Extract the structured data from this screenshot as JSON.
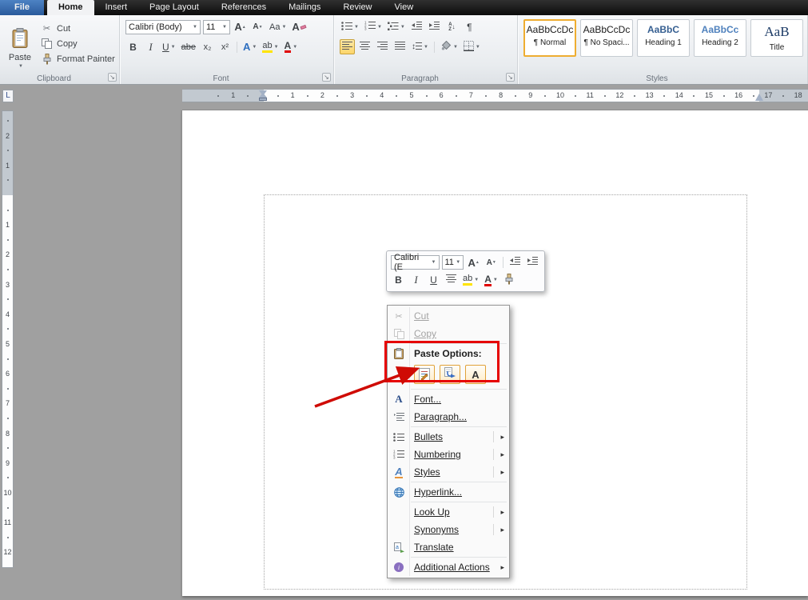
{
  "window": {
    "background_color": "#a0a0a0",
    "accent_orange": "#eead31",
    "annotation_red": "#e60202"
  },
  "tab_bar": {
    "tabs": [
      {
        "label": "File"
      },
      {
        "label": "Home"
      },
      {
        "label": "Insert"
      },
      {
        "label": "Page Layout"
      },
      {
        "label": "References"
      },
      {
        "label": "Mailings"
      },
      {
        "label": "Review"
      },
      {
        "label": "View"
      }
    ]
  },
  "ribbon": {
    "clipboard": {
      "group_label": "Clipboard",
      "paste_label": "Paste",
      "cut_label": "Cut",
      "copy_label": "Copy",
      "format_painter_label": "Format Painter"
    },
    "font": {
      "group_label": "Font",
      "font_name": "Calibri (Body)",
      "font_size": "11",
      "bold_label": "B",
      "italic_label": "I",
      "underline_label": "U",
      "strikethrough_label": "abe",
      "subscript_label": "x₂",
      "superscript_label": "x²",
      "change_case_label": "Aa",
      "grow_font_label": "A",
      "shrink_font_label": "A",
      "clear_formatting_label": "A",
      "text_effects_label": "A",
      "highlight_label": "ab",
      "font_color_label": "A"
    },
    "paragraph": {
      "group_label": "Paragraph",
      "sort_a": "A",
      "sort_z": "Z"
    },
    "styles": {
      "group_label": "Styles",
      "items": [
        {
          "preview": "AaBbCcDc",
          "label": "¶ Normal",
          "selected": true
        },
        {
          "preview": "AaBbCcDc",
          "label": "¶ No Spaci..."
        },
        {
          "preview": "AaBbC",
          "label": "Heading 1"
        },
        {
          "preview": "AaBbCc",
          "label": "Heading 2"
        },
        {
          "preview": "AaB",
          "label": "Title"
        }
      ],
      "heading1_color": "#365f91",
      "heading2_color": "#4f81bd"
    }
  },
  "ruler": {
    "tab_selector": "L",
    "h_margin_numbers": [
      "1"
    ],
    "h_numbers": [
      "1",
      "2",
      "3",
      "4",
      "5",
      "6",
      "7",
      "8",
      "9",
      "10",
      "11",
      "12",
      "13",
      "14",
      "15",
      "16",
      "17",
      "18"
    ],
    "v_margin_numbers": [
      "1",
      "2"
    ],
    "v_numbers": [
      "1",
      "2",
      "3",
      "4",
      "5",
      "6",
      "7",
      "8",
      "9",
      "10",
      "11",
      "12"
    ]
  },
  "mini_toolbar": {
    "font_name": "Calibri (E",
    "font_size": "11",
    "bold_label": "B",
    "italic_label": "I",
    "underline_label": "U",
    "highlight_label": "ab",
    "font_color_label": "A",
    "grow_font_label": "A",
    "shrink_font_label": "A"
  },
  "context_menu": {
    "items": [
      {
        "label": "Cut",
        "disabled": true
      },
      {
        "label": "Copy",
        "disabled": true
      },
      {
        "label": "Paste Options:",
        "bold": true
      },
      {
        "label": "Font..."
      },
      {
        "label": "Paragraph..."
      },
      {
        "label": "Bullets",
        "submenu": true
      },
      {
        "label": "Numbering",
        "submenu": true
      },
      {
        "label": "Styles",
        "submenu": true
      },
      {
        "label": "Hyperlink..."
      },
      {
        "label": "Look Up",
        "submenu": true
      },
      {
        "label": "Synonyms",
        "submenu": true
      },
      {
        "label": "Translate"
      },
      {
        "label": "Additional Actions",
        "submenu": true
      }
    ],
    "paste_option_buttons": [
      {
        "name": "keep-source-formatting"
      },
      {
        "name": "merge-formatting"
      },
      {
        "name": "keep-text-only",
        "label": "A"
      }
    ]
  },
  "icons": {
    "scissors": "✂",
    "dropdown_caret": "▼",
    "up_caret": "▲",
    "submenu_arrow": "▸",
    "launcher_arrow": "↘",
    "pilcrow": "¶",
    "updown_arrow": "↕",
    "sort_arrow": "↓",
    "letter_a": "a",
    "letter_i": "i",
    "letter_A": "A"
  }
}
